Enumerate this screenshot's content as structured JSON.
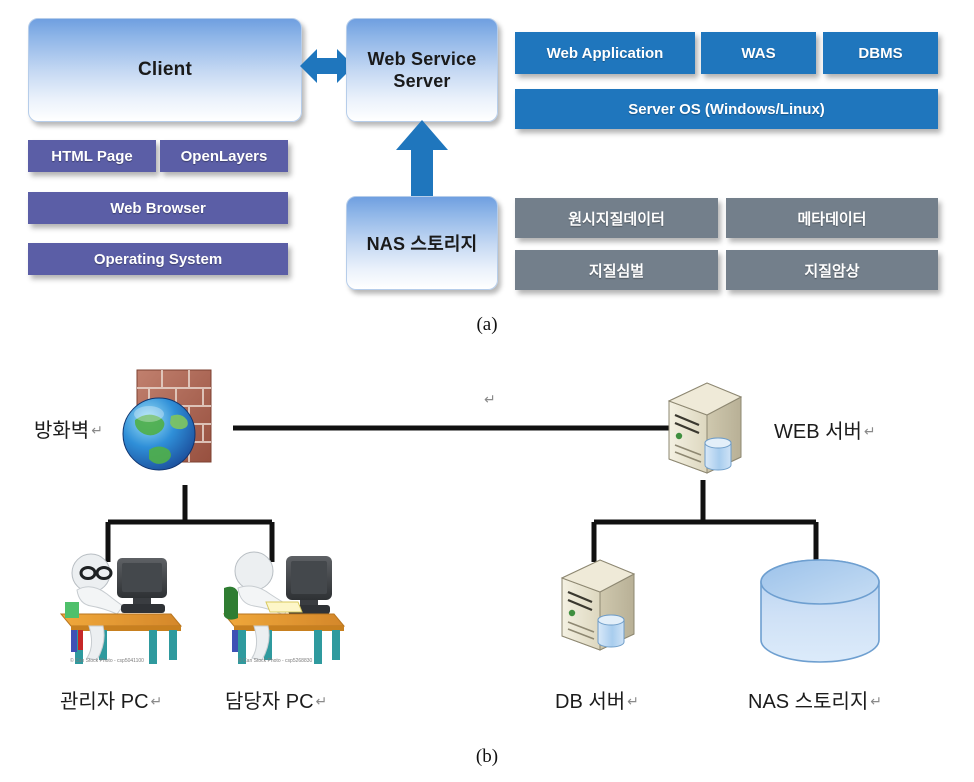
{
  "figures": [
    {
      "caption": "(a)",
      "name": "system-architecture-diagram",
      "client": {
        "label": "Client"
      },
      "client_stack": [
        {
          "label": "HTML Page"
        },
        {
          "label": "OpenLayers"
        },
        {
          "label": "Web Browser"
        },
        {
          "label": "Operating System"
        }
      ],
      "web_service_server": {
        "label": "Web Service\nServer",
        "line1": "Web Service",
        "line2": "Server"
      },
      "nas_storage": {
        "label": "NAS 스토리지"
      },
      "server_stack": [
        {
          "label": "Web Application"
        },
        {
          "label": "WAS"
        },
        {
          "label": "DBMS"
        },
        {
          "label": "Server OS (Windows/Linux)"
        }
      ],
      "data_stack": [
        {
          "label": "원시지질데이터"
        },
        {
          "label": "메타데이터"
        },
        {
          "label": "지질심벌"
        },
        {
          "label": "지질암상"
        }
      ],
      "arrows": [
        {
          "name": "client-server-bidirectional-arrow",
          "direction": "left-right"
        },
        {
          "name": "nas-to-server-arrow",
          "direction": "up"
        }
      ]
    },
    {
      "caption": "(b)",
      "name": "network-topology-diagram",
      "nodes": [
        {
          "name": "firewall",
          "label": "방화벽",
          "mark": "↵",
          "icon": "firewall-globe-icon"
        },
        {
          "name": "web-server",
          "label": "WEB 서버",
          "mark": "↵",
          "icon": "server-tower-icon"
        },
        {
          "name": "admin-pc",
          "label": "관리자 PC",
          "mark": "↵",
          "icon": "workstation-icon"
        },
        {
          "name": "operator-pc",
          "label": "담당자 PC",
          "mark": "↵",
          "icon": "workstation-icon"
        },
        {
          "name": "db-server",
          "label": "DB 서버",
          "mark": "↵",
          "icon": "server-tower-icon"
        },
        {
          "name": "nas-storage",
          "label": "NAS 스토리지",
          "mark": "↵",
          "icon": "storage-cylinder-icon"
        }
      ],
      "stray_mark": "↵",
      "watermarks": [
        "© Can Stock Photo - csp5041100",
        "© Can Stock Photo - csp5268830"
      ]
    }
  ],
  "colors": {
    "accent_blue": "#1f76bd",
    "purple": "#5b5ea6",
    "gray": "#737f8b",
    "arrow_blue": "#1f76bd",
    "line_black": "#111111",
    "storage_blue": "#a8c8ea"
  }
}
